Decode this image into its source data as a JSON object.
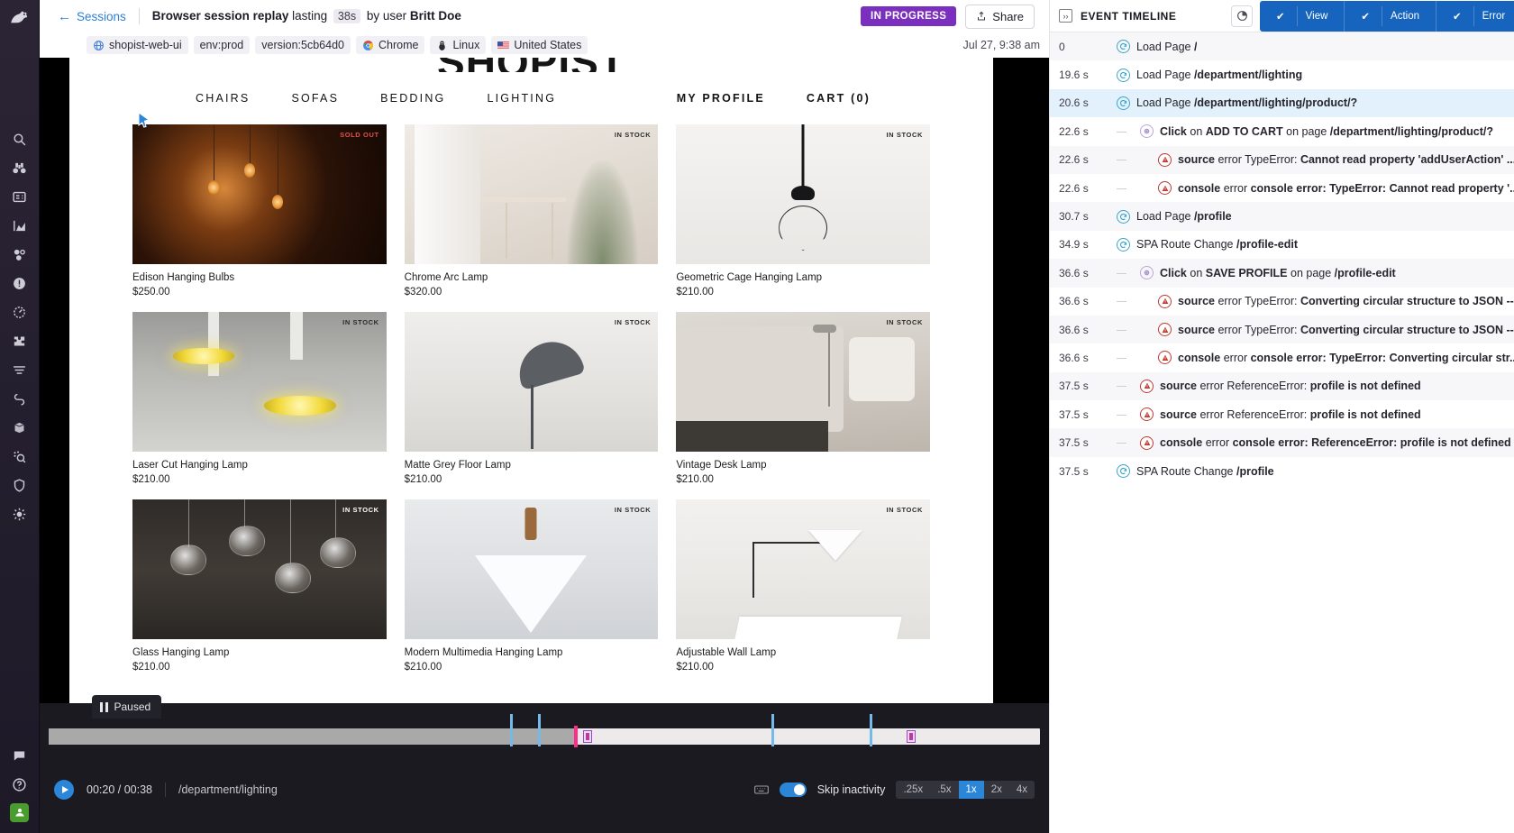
{
  "header": {
    "back_label": "Sessions",
    "title_main": "Browser session replay",
    "title_lasting": "lasting",
    "duration": "38s",
    "title_by": "by user",
    "user": "Britt Doe",
    "status_badge": "IN PROGRESS",
    "share_label": "Share",
    "date": "Jul 27, 9:38 am"
  },
  "meta": {
    "service": "shopist-web-ui",
    "env": "env:prod",
    "version": "version:5cb64d0",
    "browser": "Chrome",
    "os": "Linux",
    "country": "United States"
  },
  "replay": {
    "site_logo": "SHOPIST",
    "nav_left": [
      "CHAIRS",
      "SOFAS",
      "BEDDING",
      "LIGHTING"
    ],
    "nav_right": [
      "MY PROFILE",
      "CART (0)"
    ],
    "products": [
      {
        "name": "Edison Hanging Bulbs",
        "price": "$250.00",
        "tag": "SOLD OUT",
        "tag_kind": "sold",
        "art": "a-bulbs"
      },
      {
        "name": "Chrome Arc Lamp",
        "price": "$320.00",
        "tag": "IN STOCK",
        "tag_kind": "dark",
        "art": "a-arc"
      },
      {
        "name": "Geometric Cage Hanging Lamp",
        "price": "$210.00",
        "tag": "IN STOCK",
        "tag_kind": "dark",
        "art": "a-cage"
      },
      {
        "name": "Laser Cut Hanging Lamp",
        "price": "$210.00",
        "tag": "IN STOCK",
        "tag_kind": "dark",
        "art": "a-laser"
      },
      {
        "name": "Matte Grey Floor Lamp",
        "price": "$210.00",
        "tag": "IN STOCK",
        "tag_kind": "dark",
        "art": "a-matte"
      },
      {
        "name": "Vintage Desk Lamp",
        "price": "$210.00",
        "tag": "IN STOCK",
        "tag_kind": "dark",
        "art": "a-desk"
      },
      {
        "name": "Glass Hanging Lamp",
        "price": "$210.00",
        "tag": "IN STOCK",
        "tag_kind": "light",
        "art": "a-glass"
      },
      {
        "name": "Modern Multimedia Hanging Lamp",
        "price": "$210.00",
        "tag": "IN STOCK",
        "tag_kind": "dark",
        "art": "a-multi"
      },
      {
        "name": "Adjustable Wall Lamp",
        "price": "$210.00",
        "tag": "IN STOCK",
        "tag_kind": "dark",
        "art": "a-wall"
      }
    ]
  },
  "player": {
    "paused_label": "Paused",
    "current_time": "00:20",
    "total_time": "00:38",
    "time_display": "00:20 / 00:38",
    "current_url": "/department/lighting",
    "skip_inactivity_label": "Skip inactivity",
    "skip_inactivity_on": true,
    "speeds": [
      ".25x",
      ".5x",
      "1x",
      "2x",
      "4x"
    ],
    "active_speed": "1x",
    "progress_percent": 53
  },
  "right_panel": {
    "title": "EVENT TIMELINE",
    "filters": [
      {
        "label": "View",
        "active": true
      },
      {
        "label": "Action",
        "active": true
      },
      {
        "label": "Error",
        "active": true
      }
    ],
    "events": [
      {
        "time": "0",
        "indent": 0,
        "icon": "view",
        "selected": false,
        "parts": [
          {
            "t": "Load Page ",
            "b": false
          },
          {
            "t": "/",
            "b": true
          }
        ]
      },
      {
        "time": "19.6 s",
        "indent": 0,
        "icon": "view",
        "selected": false,
        "parts": [
          {
            "t": "Load Page ",
            "b": false
          },
          {
            "t": "/department/lighting",
            "b": true
          }
        ]
      },
      {
        "time": "20.6 s",
        "indent": 0,
        "icon": "view",
        "selected": true,
        "parts": [
          {
            "t": "Load Page ",
            "b": false
          },
          {
            "t": "/department/lighting/product/?",
            "b": true
          }
        ]
      },
      {
        "time": "22.6 s",
        "indent": 1,
        "icon": "action",
        "selected": false,
        "parts": [
          {
            "t": "Click",
            "b": true
          },
          {
            "t": " on ",
            "b": false
          },
          {
            "t": "ADD TO CART",
            "b": true
          },
          {
            "t": " on page ",
            "b": false
          },
          {
            "t": "/department/lighting/product/?",
            "b": true
          }
        ]
      },
      {
        "time": "22.6 s",
        "indent": 2,
        "icon": "error",
        "selected": false,
        "parts": [
          {
            "t": "source",
            "b": true
          },
          {
            "t": " error TypeError: ",
            "b": false
          },
          {
            "t": "Cannot read property 'addUserAction' ...",
            "b": true
          }
        ]
      },
      {
        "time": "22.6 s",
        "indent": 2,
        "icon": "error",
        "selected": false,
        "parts": [
          {
            "t": "console",
            "b": true
          },
          {
            "t": " error ",
            "b": false
          },
          {
            "t": "console error: TypeError: Cannot read property '...",
            "b": true
          }
        ]
      },
      {
        "time": "30.7 s",
        "indent": 0,
        "icon": "view",
        "selected": false,
        "parts": [
          {
            "t": "Load Page ",
            "b": false
          },
          {
            "t": "/profile",
            "b": true
          }
        ]
      },
      {
        "time": "34.9 s",
        "indent": 0,
        "icon": "view",
        "selected": false,
        "parts": [
          {
            "t": "SPA Route Change ",
            "b": false
          },
          {
            "t": "/profile-edit",
            "b": true
          }
        ]
      },
      {
        "time": "36.6 s",
        "indent": 1,
        "icon": "action",
        "selected": false,
        "parts": [
          {
            "t": "Click",
            "b": true
          },
          {
            "t": " on ",
            "b": false
          },
          {
            "t": "SAVE PROFILE",
            "b": true
          },
          {
            "t": " on page ",
            "b": false
          },
          {
            "t": "/profile-edit",
            "b": true
          }
        ]
      },
      {
        "time": "36.6 s",
        "indent": 2,
        "icon": "error",
        "selected": false,
        "parts": [
          {
            "t": "source",
            "b": true
          },
          {
            "t": " error TypeError: ",
            "b": false
          },
          {
            "t": "Converting circular structure to JSON --...",
            "b": true
          }
        ]
      },
      {
        "time": "36.6 s",
        "indent": 2,
        "icon": "error",
        "selected": false,
        "parts": [
          {
            "t": "source",
            "b": true
          },
          {
            "t": " error TypeError: ",
            "b": false
          },
          {
            "t": "Converting circular structure to JSON --...",
            "b": true
          }
        ]
      },
      {
        "time": "36.6 s",
        "indent": 2,
        "icon": "error",
        "selected": false,
        "parts": [
          {
            "t": "console",
            "b": true
          },
          {
            "t": " error ",
            "b": false
          },
          {
            "t": "console error: TypeError: Converting circular str...",
            "b": true
          }
        ]
      },
      {
        "time": "37.5 s",
        "indent": 1,
        "icon": "error",
        "selected": false,
        "parts": [
          {
            "t": "source",
            "b": true
          },
          {
            "t": " error ReferenceError: ",
            "b": false
          },
          {
            "t": "profile is not defined",
            "b": true
          }
        ]
      },
      {
        "time": "37.5 s",
        "indent": 1,
        "icon": "error",
        "selected": false,
        "parts": [
          {
            "t": "source",
            "b": true
          },
          {
            "t": " error ReferenceError: ",
            "b": false
          },
          {
            "t": "profile is not defined",
            "b": true
          }
        ]
      },
      {
        "time": "37.5 s",
        "indent": 1,
        "icon": "error",
        "selected": false,
        "parts": [
          {
            "t": "console",
            "b": true
          },
          {
            "t": " error ",
            "b": false
          },
          {
            "t": "console error: ReferenceError: profile is not defined",
            "b": true
          }
        ]
      },
      {
        "time": "37.5 s",
        "indent": 0,
        "icon": "view",
        "selected": false,
        "parts": [
          {
            "t": "SPA Route Change ",
            "b": false
          },
          {
            "t": "/profile",
            "b": true
          }
        ]
      }
    ]
  },
  "sidebar": {
    "items": [
      "search-icon",
      "watchdog-icon",
      "dashboard-icon",
      "analytics-icon",
      "rum-icon",
      "incidents-icon",
      "synthetics-icon",
      "integrations-icon",
      "logs-icon",
      "apm-icon",
      "database-icon",
      "profiler-icon",
      "security-icon",
      "settings-icon"
    ],
    "bottom_items": [
      "chat-icon",
      "help-icon",
      "account-avatar"
    ]
  },
  "colors": {
    "accent_blue": "#2b86d8",
    "filter_blue": "#1664bd",
    "status_purple": "#7b2fbe",
    "playhead_pink": "#ff2d8a",
    "error_red": "#c0392f",
    "view_teal": "#3aa5c9"
  }
}
